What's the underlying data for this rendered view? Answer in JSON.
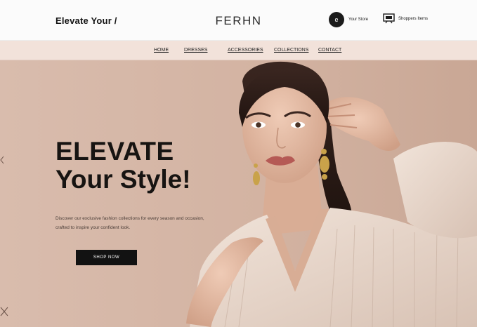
{
  "header": {
    "tagline": "Elevate Your /",
    "brand": "FERHN",
    "account_icon_glyph": "e",
    "account_label": "Your Store",
    "bag_label": "Shoppers Items"
  },
  "nav": {
    "items": [
      "HOME",
      "DRESSES",
      "ACCESSORIES",
      "COLLECTIONS",
      "CONTACT"
    ]
  },
  "hero": {
    "headline_line1": "ELEVATE",
    "headline_line2": "Your Style!",
    "description": "Discover our exclusive fashion collections for every season and occasion, crafted to inspire your confident look.",
    "cta_label": "SHOP NOW"
  },
  "colors": {
    "background": "#d7b9a8",
    "nav_background": "#f2e2da",
    "accent": "#121212"
  },
  "icons": [
    "account-icon",
    "shopping-bag-icon",
    "left-arrow-icon",
    "close-icon"
  ]
}
